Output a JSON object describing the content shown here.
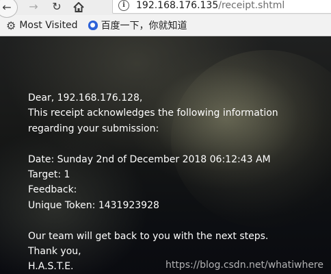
{
  "browser": {
    "url_host": "192.168.176.135",
    "url_path": "/receipt.shtml",
    "bookmarks": [
      {
        "label": "Most Visited",
        "icon": "gear-icon"
      },
      {
        "label": "百度一下，你就知道",
        "icon": "baidu-paw-icon"
      }
    ]
  },
  "receipt": {
    "greeting": "Dear, 192.168.176.128,",
    "intro_line1": "This receipt acknowledges the following information",
    "intro_line2": "regarding your submission:",
    "date": "Date: Sunday 2nd of December 2018 06:12:43 AM",
    "target": "Target: 1",
    "feedback": "Feedback:",
    "token": "Unique Token: 1431923928",
    "followup": "Our team will get back to you with the next steps.",
    "thanks": "Thank you,",
    "signature": "H.A.S.T.E."
  },
  "watermark": "https://blog.csdn.net/whatiwhere"
}
